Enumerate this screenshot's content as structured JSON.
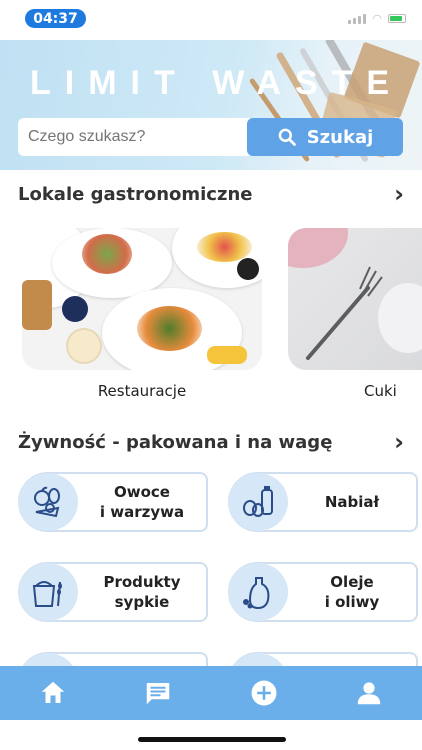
{
  "status": {
    "time": "04:37"
  },
  "hero": {
    "title": "LIMIT WASTE"
  },
  "search": {
    "placeholder": "Czego szukasz?",
    "button_label": "Szukaj"
  },
  "sections": [
    {
      "title": "Lokale gastronomiczne"
    },
    {
      "title": "Żywność - pakowana i na wagę"
    }
  ],
  "venues": [
    {
      "label": "Restauracje"
    },
    {
      "label": "Cuki"
    }
  ],
  "categories": [
    {
      "label": "Owoce\ni warzywa",
      "icon": "fruit-vegetables-icon"
    },
    {
      "label": "Nabiał",
      "icon": "dairy-icon"
    },
    {
      "label": "Produkty\nsypkie",
      "icon": "bulk-products-icon"
    },
    {
      "label": "Oleje\ni oliwy",
      "icon": "oils-icon"
    }
  ],
  "nav": [
    "home-icon",
    "messages-icon",
    "add-icon",
    "profile-icon"
  ],
  "colors": {
    "accent": "#5fa3e6",
    "nav_bg": "#6aaeea",
    "icon_bg": "#d6e7f7",
    "time_pill": "#1f7ae0"
  }
}
